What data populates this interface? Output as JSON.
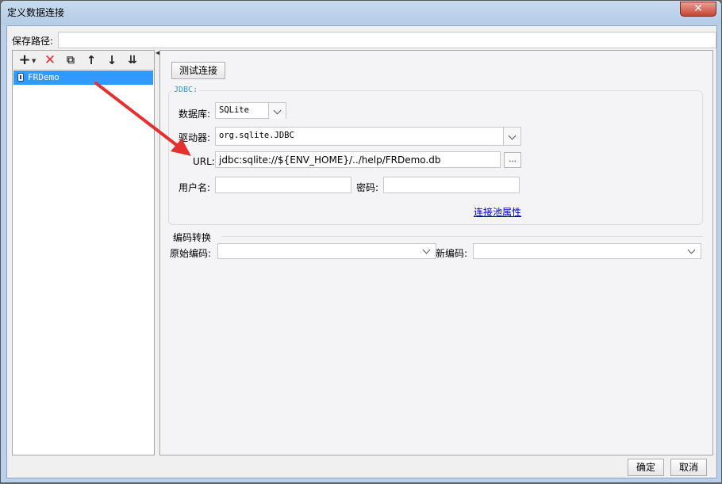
{
  "window": {
    "title": "定义数据连接",
    "close_icon": "✕"
  },
  "save_path": {
    "label": "保存路径:",
    "value": ""
  },
  "toolbar": {
    "add": "+",
    "add_caret": "▼",
    "delete": "✕",
    "copy": "⧉",
    "up": "↑",
    "down": "↓",
    "sort": "⇊"
  },
  "tree": {
    "items": [
      {
        "label": "FRDemo"
      }
    ]
  },
  "splitter": {
    "collapse": "◀"
  },
  "test_button": "测试连接",
  "jdbc": {
    "legend": "JDBC:",
    "database_label": "数据库:",
    "database_value": "SQLite",
    "driver_label": "驱动器:",
    "driver_value": "org.sqlite.JDBC",
    "url_label": "URL:",
    "url_value": "jdbc:sqlite://${ENV_HOME}/../help/FRDemo.db",
    "url_browse": "...",
    "username_label": "用户名:",
    "username_value": "",
    "password_label": "密码:",
    "password_value": "",
    "pool_link": "连接池属性"
  },
  "encoding": {
    "title": "编码转换",
    "original_label": "原始编码:",
    "original_value": "",
    "new_label": "新编码:",
    "new_value": ""
  },
  "buttons": {
    "ok": "确定",
    "cancel": "取消"
  },
  "colors": {
    "selection": "#3399ff",
    "annotation_arrow": "#e53030",
    "close": "#c7432f",
    "link": "#0000cc"
  }
}
